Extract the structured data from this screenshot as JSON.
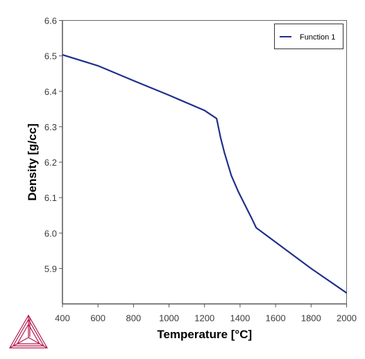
{
  "chart_data": {
    "type": "line",
    "title": "",
    "xlabel": "Temperature [°C]",
    "ylabel": "Density [g/cc]",
    "xlim": [
      400,
      2000
    ],
    "ylim": [
      5.8,
      6.6
    ],
    "xticks": [
      400,
      600,
      800,
      1000,
      1200,
      1400,
      1600,
      1800,
      2000
    ],
    "xtick_labels": [
      "400",
      "600",
      "800",
      "1000",
      "1200",
      "1400",
      "1600",
      "1800",
      "2000"
    ],
    "yticks": [
      5.9,
      6.0,
      6.1,
      6.2,
      6.3,
      6.4,
      6.5,
      6.6
    ],
    "ytick_labels": [
      "5.9",
      "6.0",
      "6.1",
      "6.2",
      "6.3",
      "6.4",
      "6.5",
      "6.6"
    ],
    "grid": false,
    "legend": {
      "placement": "top-right",
      "entries": [
        "Function 1"
      ]
    },
    "series": [
      {
        "name": "Function 1",
        "color": "#1f2f8a",
        "x": [
          400,
          600,
          800,
          1000,
          1200,
          1268,
          1290,
          1312,
          1351,
          1391,
          1430,
          1469,
          1491,
          1800,
          2000
        ],
        "y": [
          6.503,
          6.472,
          6.43,
          6.389,
          6.346,
          6.323,
          6.27,
          6.227,
          6.162,
          6.116,
          6.077,
          6.038,
          6.015,
          5.9,
          5.831
        ]
      }
    ]
  },
  "logo": {
    "name": "thermo-calc-logo",
    "color": "#b5174a"
  }
}
